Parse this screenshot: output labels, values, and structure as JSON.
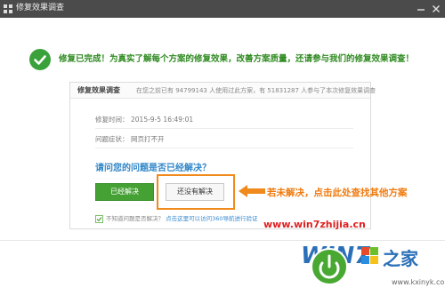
{
  "window": {
    "title": "修复效果调查"
  },
  "header": {
    "message": "修复已完成！为真实了解每个方案的修复效果，改善方案质量，还请参与我们的修复效果调查！"
  },
  "card": {
    "title": "修复效果调查",
    "stats": "在您之前已有 94799143 人使用过此方案，有 51831287 人参与了本次修复效果调查",
    "fields": [
      {
        "label": "修复时间：",
        "value": "2015-9-5 16:49:01"
      },
      {
        "label": "问题症状：",
        "value": "网页打不开"
      }
    ],
    "question": "请问您的问题是否已经解决？",
    "solved_button": "已经解决",
    "unsolved_button": "还没有解决",
    "footer_prefix": "不知道问题是否解决？",
    "footer_link": "点击这里可以访问360导航进行验证"
  },
  "annotation": {
    "text": "若未解决，点击此处查找其他方案"
  },
  "watermark": {
    "site": "www.win7zhijia.cn",
    "logo_text": "WIN7 之家",
    "logo_url": "www.kxinyk.com"
  },
  "colors": {
    "titlebar": "#4b4b4b",
    "success_green": "#3ba23b",
    "question_blue": "#2f86c8",
    "annotation_orange": "#f08a1c",
    "watermark_red": "#e02020"
  }
}
